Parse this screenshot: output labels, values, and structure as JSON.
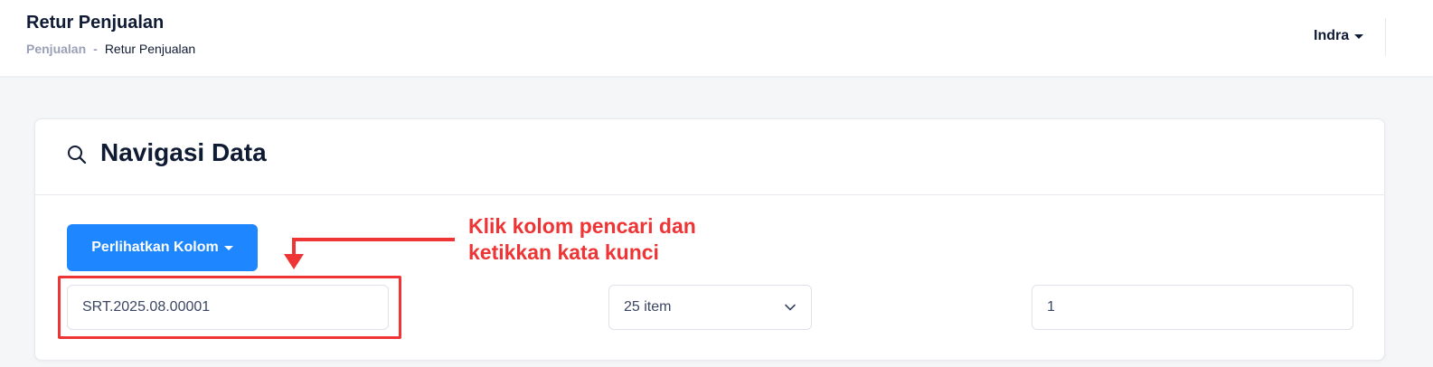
{
  "header": {
    "title": "Retur Penjualan",
    "breadcrumb": {
      "parent": "Penjualan",
      "separator": "-",
      "current": "Retur Penjualan"
    },
    "user": "Indra"
  },
  "card": {
    "title": "Navigasi Data",
    "title_icon": "search-icon",
    "show_columns_button": "Perlihatkan Kolom",
    "search_value": "SRT.2025.08.00001",
    "per_page_selected": "25 item",
    "page_value": "1"
  },
  "annotation": {
    "text_line1": "Klik kolom pencari dan",
    "text_line2": "ketikkan kata kunci",
    "color": "#ee3434"
  },
  "colors": {
    "primary": "#1e87ff",
    "text_dark": "#0f1a33",
    "text_muted": "#9aa0b5"
  }
}
